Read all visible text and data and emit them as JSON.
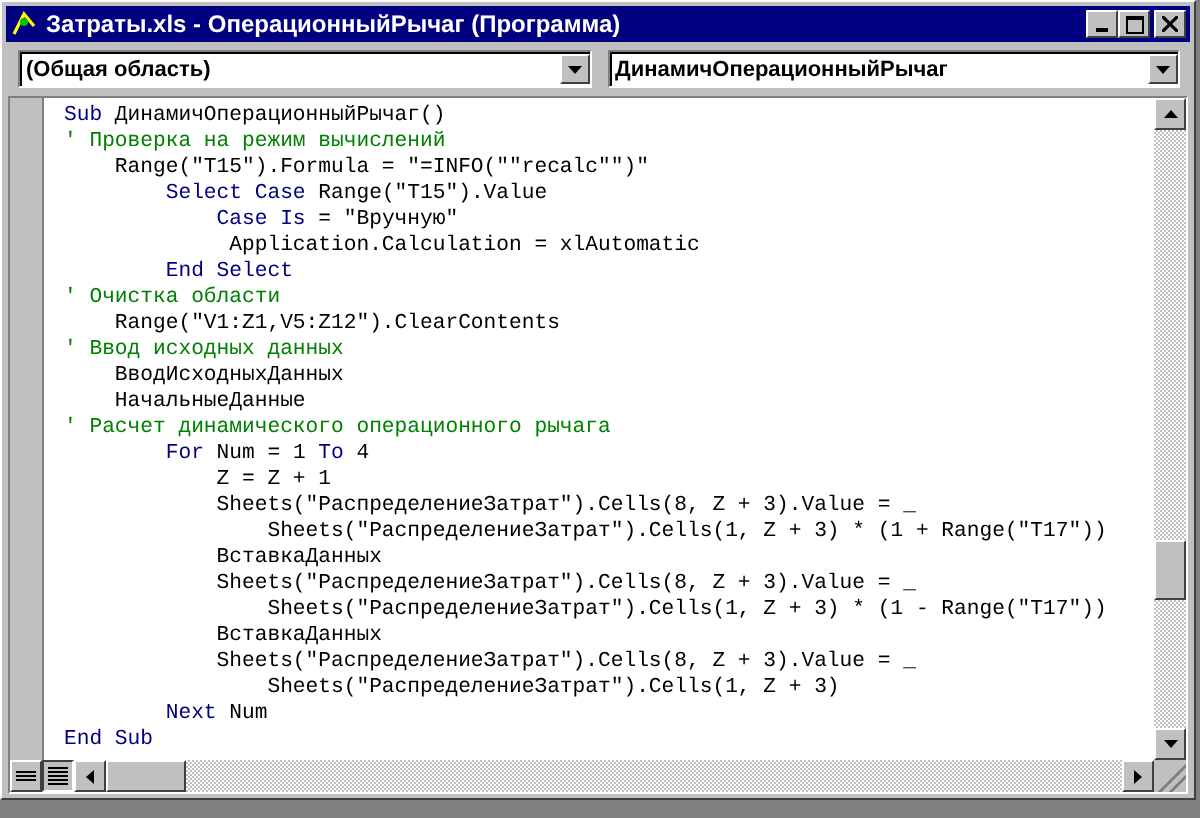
{
  "window": {
    "title": "Затраты.xls - ОперационныйРычаг (Программа)"
  },
  "object_box": {
    "value": "(Общая область)"
  },
  "procedure_box": {
    "value": "ДинамичОперационныйРычаг"
  },
  "code_lines": [
    [
      {
        "kind": "keyword",
        "text": "Sub"
      },
      {
        "kind": "code",
        "text": " ДинамичОперационныйРычаг()"
      }
    ],
    [
      {
        "kind": "comment",
        "text": "' Проверка на режим вычислений"
      }
    ],
    [
      {
        "kind": "code",
        "text": "    Range(\"T15\").Formula = \"=INFO(\"\"recalc\"\")\""
      }
    ],
    [
      {
        "kind": "keyword",
        "text": "        Select Case"
      },
      {
        "kind": "code",
        "text": " Range(\"T15\").Value"
      }
    ],
    [
      {
        "kind": "keyword",
        "text": "            Case Is"
      },
      {
        "kind": "code",
        "text": " = \"Вручную\""
      }
    ],
    [
      {
        "kind": "code",
        "text": "             Application.Calculation = xlAutomatic"
      }
    ],
    [
      {
        "kind": "keyword",
        "text": "        End Select"
      }
    ],
    [
      {
        "kind": "comment",
        "text": "' Очистка области"
      }
    ],
    [
      {
        "kind": "code",
        "text": "    Range(\"V1:Z1,V5:Z12\").ClearContents"
      }
    ],
    [
      {
        "kind": "comment",
        "text": "' Ввод исходных данных"
      }
    ],
    [
      {
        "kind": "code",
        "text": "    ВводИсходныхДанных"
      }
    ],
    [
      {
        "kind": "code",
        "text": "    НачальныеДанные"
      }
    ],
    [
      {
        "kind": "comment",
        "text": "' Расчет динамического операционного рычага"
      }
    ],
    [
      {
        "kind": "keyword",
        "text": "        For"
      },
      {
        "kind": "code",
        "text": " Num = 1 "
      },
      {
        "kind": "keyword",
        "text": "To"
      },
      {
        "kind": "code",
        "text": " 4"
      }
    ],
    [
      {
        "kind": "code",
        "text": "            Z = Z + 1"
      }
    ],
    [
      {
        "kind": "code",
        "text": "            Sheets(\"РаспределениеЗатрат\").Cells(8, Z + 3).Value = _"
      }
    ],
    [
      {
        "kind": "code",
        "text": "                Sheets(\"РаспределениеЗатрат\").Cells(1, Z + 3) * (1 + Range(\"T17\"))"
      }
    ],
    [
      {
        "kind": "code",
        "text": "            ВставкаДанных"
      }
    ],
    [
      {
        "kind": "code",
        "text": "            Sheets(\"РаспределениеЗатрат\").Cells(8, Z + 3).Value = _"
      }
    ],
    [
      {
        "kind": "code",
        "text": "                Sheets(\"РаспределениеЗатрат\").Cells(1, Z + 3) * (1 - Range(\"T17\"))"
      }
    ],
    [
      {
        "kind": "code",
        "text": "            ВставкаДанных"
      }
    ],
    [
      {
        "kind": "code",
        "text": "            Sheets(\"РаспределениеЗатрат\").Cells(8, Z + 3).Value = _"
      }
    ],
    [
      {
        "kind": "code",
        "text": "                Sheets(\"РаспределениеЗатрат\").Cells(1, Z + 3)"
      }
    ],
    [
      {
        "kind": "keyword",
        "text": "        Next"
      },
      {
        "kind": "code",
        "text": " Num"
      }
    ],
    [
      {
        "kind": "keyword",
        "text": "End Sub"
      }
    ]
  ]
}
